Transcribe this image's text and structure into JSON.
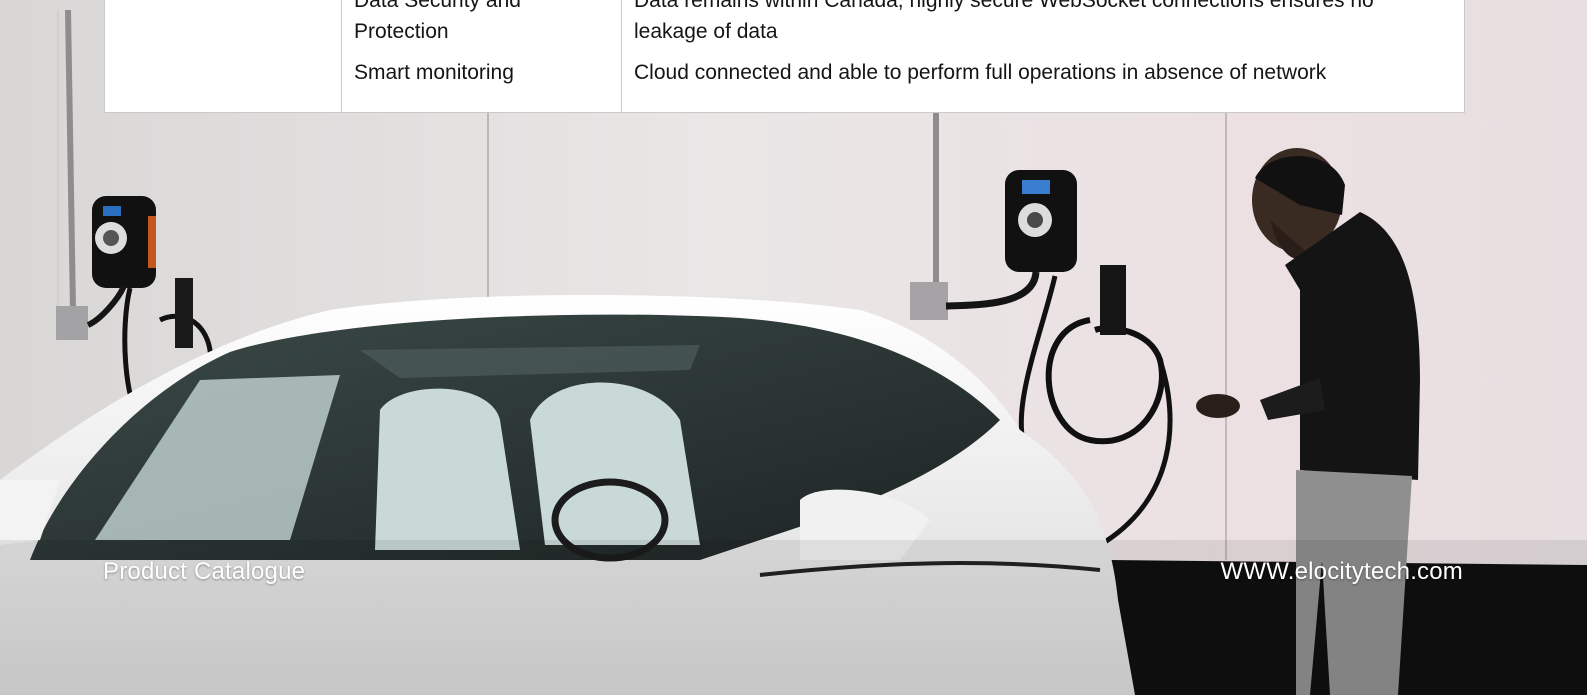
{
  "spec_table": {
    "rows": [
      {
        "feature": "Data Security and Protection",
        "description": "Data remains within Canada, highly secure WebSocket connections ensures no leakage of data"
      },
      {
        "feature": "Smart monitoring",
        "description": "Cloud connected and able to perform full operations in absence of network"
      }
    ]
  },
  "footer": {
    "left_text": "Product Catalogue",
    "right_text": "WWW.elocitytech.com"
  },
  "colors": {
    "wall": "#e6e2e3",
    "floor": "#101010",
    "car_body": "#f2f2f2",
    "person_shirt": "#141414",
    "pants": "#8f8f8f"
  }
}
